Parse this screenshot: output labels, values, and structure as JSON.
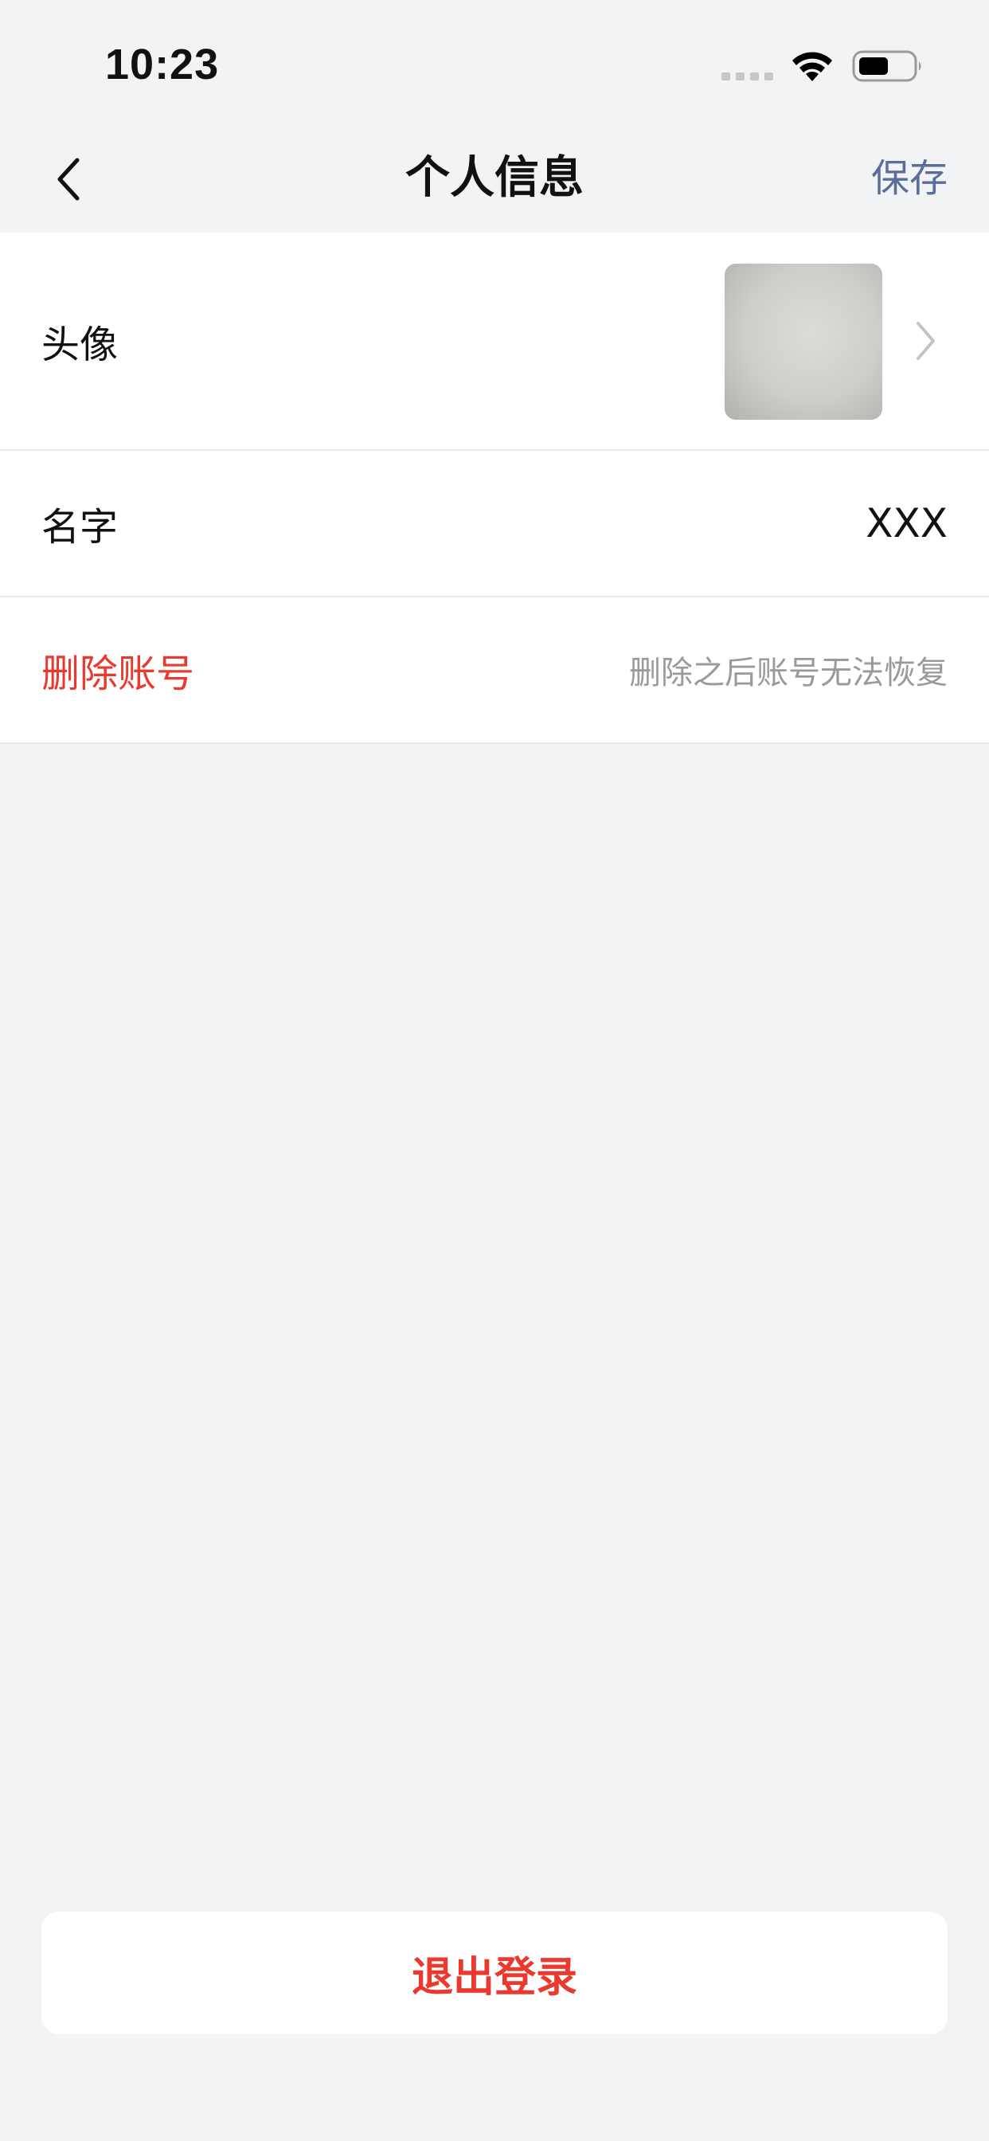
{
  "status_bar": {
    "time": "10:23"
  },
  "nav": {
    "title": "个人信息",
    "save_label": "保存"
  },
  "rows": {
    "avatar": {
      "label": "头像"
    },
    "name": {
      "label": "名字",
      "value": "XXX"
    },
    "delete_account": {
      "label": "删除账号",
      "hint": "删除之后账号无法恢复"
    }
  },
  "logout": {
    "label": "退出登录"
  },
  "colors": {
    "danger": "#ea3a2f",
    "accent": "#5b6e9a",
    "background": "#f2f3f5"
  },
  "icons": [
    "signal-icon",
    "wifi-icon",
    "battery-icon",
    "back-arrow-icon",
    "chevron-right-icon"
  ]
}
